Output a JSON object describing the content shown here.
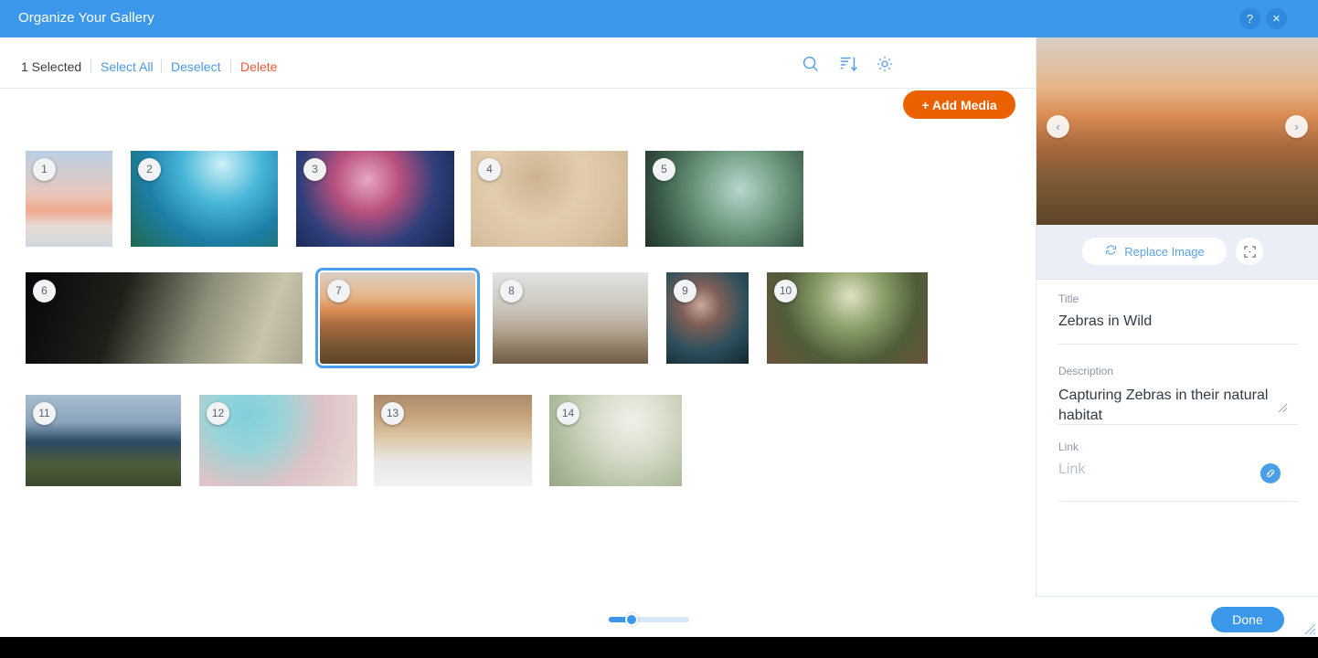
{
  "window": {
    "title": "Organize Your Gallery",
    "help_label": "?",
    "close_label": "×",
    "accent_blue": "#3b97e9",
    "accent_orange": "#eb6100",
    "delete_red": "#e8593c"
  },
  "toolbar": {
    "selected_count_label": "1 Selected",
    "select_all_label": "Select All",
    "deselect_label": "Deselect",
    "delete_label": "Delete",
    "search_icon": "search-icon",
    "sort_icon": "sort-icon",
    "settings_icon": "gear-icon",
    "add_media_label": "+ Add Media"
  },
  "grid": {
    "selected_index": 7,
    "thumbnails": [
      {
        "n": "1",
        "alt": "lighthouse at dusk"
      },
      {
        "n": "2",
        "alt": "sea turtle over coral reef"
      },
      {
        "n": "3",
        "alt": "colorful coral garden"
      },
      {
        "n": "4",
        "alt": "zen stone on raked sand"
      },
      {
        "n": "5",
        "alt": "spring branches bokeh"
      },
      {
        "n": "6",
        "alt": "grass stalks in dark field"
      },
      {
        "n": "7",
        "alt": "acacia tree savanna sunset with zebras"
      },
      {
        "n": "8",
        "alt": "desert valley with mountains"
      },
      {
        "n": "9",
        "alt": "dried flower head on teal"
      },
      {
        "n": "10",
        "alt": "forest path among trees"
      },
      {
        "n": "11",
        "alt": "deer on grassy hill by lake"
      },
      {
        "n": "12",
        "alt": "cherry blossom branches"
      },
      {
        "n": "13",
        "alt": "waterfall over rock ledges"
      },
      {
        "n": "14",
        "alt": "dandelion seed close up"
      }
    ]
  },
  "zoom_slider": {
    "value_percent": 28,
    "name": "thumbnail-size-slider"
  },
  "preview": {
    "prev_label": "‹",
    "next_label": "›",
    "image_alt": "acacia tree savanna sunset with zebras"
  },
  "edit_toolbar": {
    "replace_label": "Replace Image",
    "replace_icon": "refresh-icon",
    "crop_icon": "crop-expand-icon"
  },
  "details": {
    "title_label": "Title",
    "title_value": "Zebras in Wild",
    "description_label": "Description",
    "description_value": "Capturing Zebras in their natural habitat",
    "link_label": "Link",
    "link_placeholder": "Link",
    "link_icon": "chain-link-icon"
  },
  "footer": {
    "done_label": "Done"
  }
}
